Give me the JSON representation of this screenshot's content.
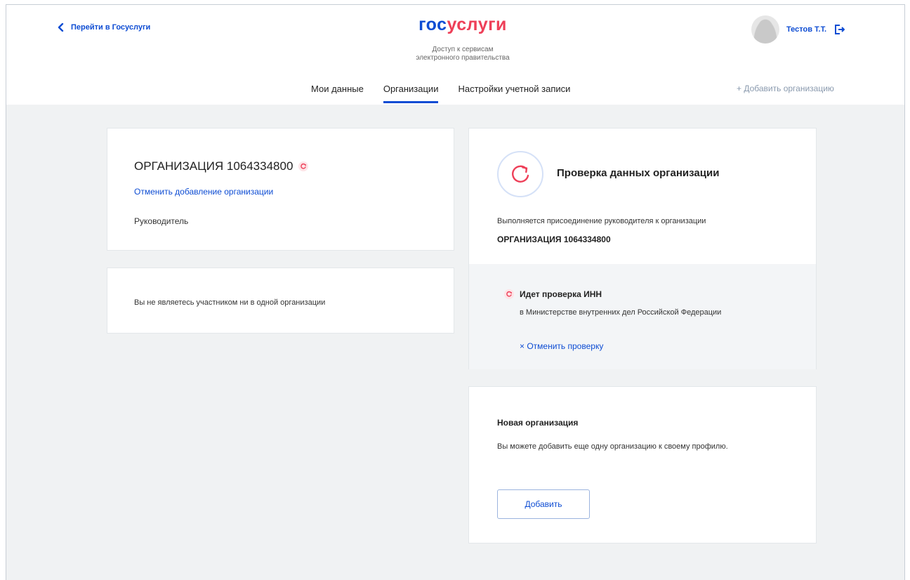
{
  "header": {
    "back_link": "Перейти в Госуслуги",
    "logo_part1": "гос",
    "logo_part2": "услуги",
    "tagline_line1": "Доступ к сервисам",
    "tagline_line2": "электронного правительства",
    "user_name": "Тестов Т.Т.",
    "add_org_link": "+ Добавить организацию"
  },
  "tabs": [
    {
      "label": "Мои данные",
      "active": false
    },
    {
      "label": "Организации",
      "active": true
    },
    {
      "label": "Настройки учетной записи",
      "active": false
    }
  ],
  "org_card": {
    "title": "ОРГАНИЗАЦИЯ 1064334800",
    "cancel_link": "Отменить добавление организации",
    "role": "Руководитель"
  },
  "membership_card": {
    "text": "Вы не являетесь участником ни в одной организации"
  },
  "verify_card": {
    "title": "Проверка данных организации",
    "description": "Выполняется присоединение руководителя к организации",
    "org_name": "ОРГАНИЗАЦИЯ 1064334800"
  },
  "check_panel": {
    "title": "Идет проверка ИНН",
    "description": "в Министерстве внутренних дел Российской Федерации",
    "cancel_link": "× Отменить проверку"
  },
  "new_org_card": {
    "title": "Новая организация",
    "description": "Вы можете добавить еще одну организацию к своему профилю.",
    "button": "Добавить"
  },
  "colors": {
    "brand_blue": "#0d4cd3",
    "brand_red": "#ee3f58",
    "background": "#f0f2f3"
  }
}
